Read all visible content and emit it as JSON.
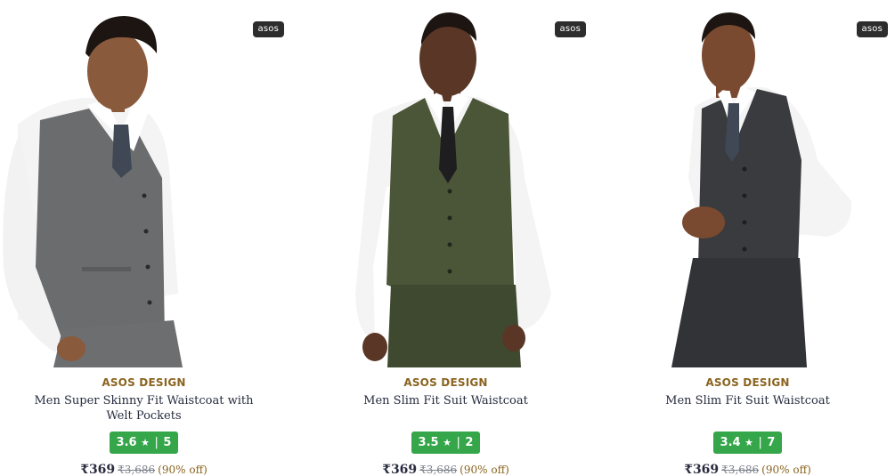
{
  "badge_label": "asos",
  "products": [
    {
      "brand": "ASOS DESIGN",
      "name": "Men Super Skinny Fit Waistcoat with Welt Pockets",
      "rating": "3.6",
      "star": "★",
      "rating_sep": "|",
      "rating_count": "5",
      "price": "₹369",
      "mrp": "₹3,686",
      "discount": "(90% off)",
      "vest_color": "#6b6c6e",
      "pants_color": "#6d6e70"
    },
    {
      "brand": "ASOS DESIGN",
      "name": "Men Slim Fit Suit Waistcoat",
      "rating": "3.5",
      "star": "★",
      "rating_sep": "|",
      "rating_count": "2",
      "price": "₹369",
      "mrp": "₹3,686",
      "discount": "(90% off)",
      "vest_color": "#4b5638",
      "pants_color": "#3e4930"
    },
    {
      "brand": "ASOS DESIGN",
      "name": "Men Slim Fit Suit Waistcoat",
      "rating": "3.4",
      "star": "★",
      "rating_sep": "|",
      "rating_count": "7",
      "price": "₹369",
      "mrp": "₹3,686",
      "discount": "(90% off)",
      "vest_color": "#3a3b3e",
      "pants_color": "#323336"
    }
  ],
  "colors": {
    "brand_text": "#8a6420",
    "rating_bg": "#35a64a",
    "skin": "#8a5a3c",
    "hair": "#1c1511",
    "shirt": "#f4f4f4",
    "tie_dark": "#1e1e20",
    "tie_grey": "#3f4854"
  }
}
